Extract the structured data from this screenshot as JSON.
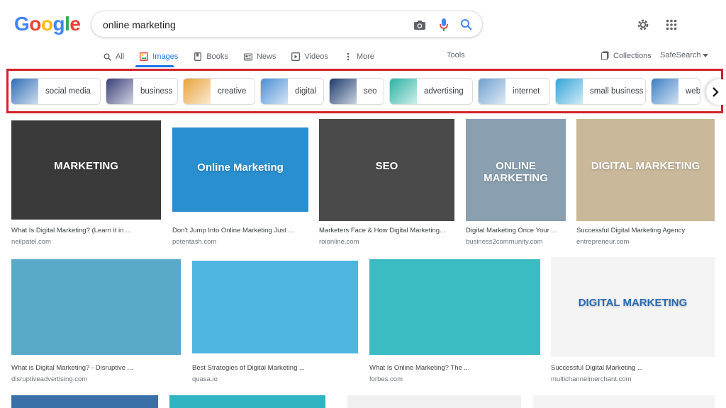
{
  "logo": {
    "letters": [
      "G",
      "o",
      "o",
      "g",
      "l",
      "e"
    ],
    "colors": [
      "#4285f4",
      "#ea4335",
      "#fbbc05",
      "#4285f4",
      "#34a853",
      "#ea4335"
    ]
  },
  "search": {
    "value": "online marketing"
  },
  "tabs": [
    {
      "label": "All",
      "icon": "search-icon",
      "active": false
    },
    {
      "label": "Images",
      "icon": "image-icon",
      "active": true
    },
    {
      "label": "Books",
      "icon": "book-icon",
      "active": false
    },
    {
      "label": "News",
      "icon": "news-icon",
      "active": false
    },
    {
      "label": "Videos",
      "icon": "video-icon",
      "active": false
    },
    {
      "label": "More",
      "icon": "more-vert-icon",
      "active": false
    }
  ],
  "tools_label": "Tools",
  "collections_label": "Collections",
  "safesearch_label": "SafeSearch",
  "chips": [
    {
      "label": "social media",
      "color": "#2f6db5"
    },
    {
      "label": "business",
      "color": "#3a3f7a"
    },
    {
      "label": "creative",
      "color": "#e8a33a"
    },
    {
      "label": "digital",
      "color": "#4a8fd6"
    },
    {
      "label": "seo",
      "color": "#1d3b6e"
    },
    {
      "label": "advertising",
      "color": "#2bb3a3"
    },
    {
      "label": "internet",
      "color": "#6fa0cf"
    },
    {
      "label": "small business",
      "color": "#33a5d8"
    },
    {
      "label": "web",
      "color": "#3c7fc4"
    }
  ],
  "results": [
    {
      "caption": "What Is Digital Marketing? (Learn it in ...",
      "source": "neilpatel.com",
      "color": "#3a3a3a",
      "image_text": "MARKETING"
    },
    {
      "caption": "Don't Jump Into Online Marketing Just ...",
      "source": "potentash.com",
      "color": "#2a8fcf",
      "image_text": "Online Marketing"
    },
    {
      "caption": "Marketers Face & How Digital Marketing...",
      "source": "roionline.com",
      "color": "#4a4a4a",
      "image_text": "SEO"
    },
    {
      "caption": "Digital Marketing Once Your ...",
      "source": "business2community.com",
      "color": "#8aa0b0",
      "image_text": "ONLINE MARKETING"
    },
    {
      "caption": "Successful Digital Marketing Agency",
      "source": "entrepreneur.com",
      "color": "#c9b89a",
      "image_text": "DIGITAL MARKETING"
    },
    {
      "caption": "What is Digital Marketing? - Disruptive ...",
      "source": "disruptiveadvertising.com",
      "color": "#5aa9c9",
      "image_text": ""
    },
    {
      "caption": "Best Strategies of Digital Marketing ...",
      "source": "quasa.io",
      "color": "#4fb6e0",
      "image_text": ""
    },
    {
      "caption": "What Is Online Marketing? The ...",
      "source": "forbes.com",
      "color": "#3bbcc2",
      "image_text": ""
    },
    {
      "caption": "Successful Digital Marketing ...",
      "source": "multichannelmerchant.com",
      "color": "#f4f4f4",
      "image_text": "DIGITAL MARKETING"
    }
  ]
}
